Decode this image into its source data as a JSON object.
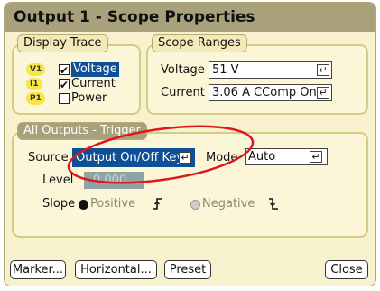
{
  "window": {
    "title": "Output 1 - Scope Properties"
  },
  "display_trace": {
    "title": "Display Trace",
    "items": [
      {
        "badge": "V1",
        "label": "Voltage",
        "checked": true,
        "selected": true
      },
      {
        "badge": "I1",
        "label": "Current",
        "checked": true,
        "selected": false
      },
      {
        "badge": "P1",
        "label": "Power",
        "checked": false,
        "selected": false
      }
    ],
    "check_mark": "✔"
  },
  "scope_ranges": {
    "title": "Scope Ranges",
    "voltage_label": "Voltage",
    "voltage_value": "51 V",
    "current_label": "Current",
    "current_value": "3.06 A CComp On"
  },
  "trigger": {
    "title": "All Outputs - Trigger",
    "source_label": "Source",
    "source_value": "Output On/Off Key",
    "mode_label": "Mode",
    "mode_value": "Auto",
    "level_label": "Level",
    "level_value": "0.000",
    "slope_label": "Slope",
    "slope_positive": "Positive",
    "slope_negative": "Negative",
    "slope_selected": "Positive"
  },
  "buttons": {
    "marker": "Marker...",
    "horizontal": "Horizontal...",
    "preset": "Preset",
    "close": "Close"
  },
  "enter_glyph": "↵",
  "colors": {
    "highlight": "#0f4f96",
    "annotation_circle": "#e0161d",
    "title_bar": "#a9a07c"
  }
}
